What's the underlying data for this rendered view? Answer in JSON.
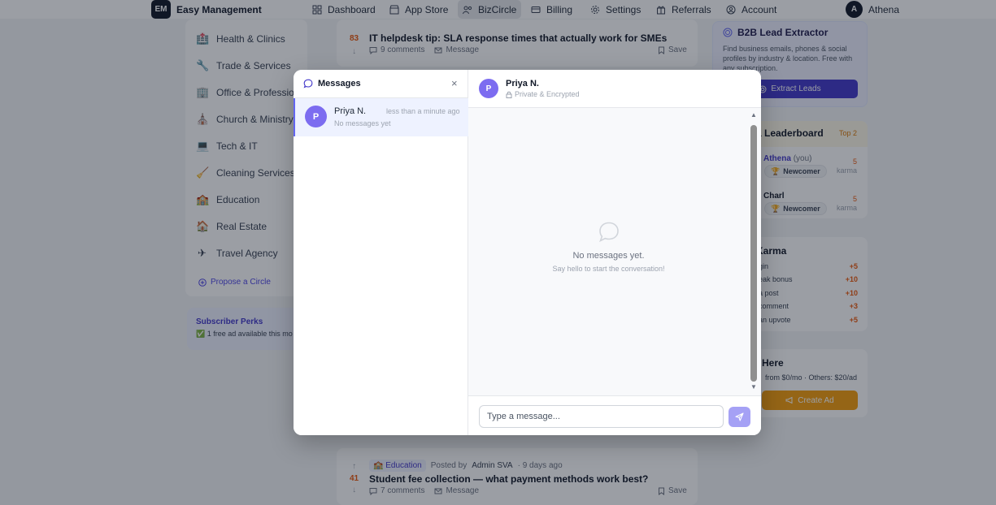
{
  "app": {
    "logo": "EM",
    "name": "Easy Management"
  },
  "nav": [
    {
      "label": "Dashboard",
      "icon": "dashboard-icon"
    },
    {
      "label": "App Store",
      "icon": "store-icon"
    },
    {
      "label": "BizCircle",
      "icon": "users-icon",
      "active": true
    },
    {
      "label": "Billing",
      "icon": "card-icon"
    },
    {
      "label": "Settings",
      "icon": "gear-icon"
    },
    {
      "label": "Referrals",
      "icon": "gift-icon"
    },
    {
      "label": "Account",
      "icon": "user-circle-icon"
    }
  ],
  "user": {
    "initial": "A",
    "name": "Athena"
  },
  "sidebar": {
    "categories": [
      {
        "label": "Health & Clinics",
        "icon": "🏥"
      },
      {
        "label": "Trade & Services",
        "icon": "🔧"
      },
      {
        "label": "Office & Professional",
        "icon": "🏢"
      },
      {
        "label": "Church & Ministry",
        "icon": "⛪"
      },
      {
        "label": "Tech & IT",
        "icon": "💻"
      },
      {
        "label": "Cleaning Services",
        "icon": "🧹"
      },
      {
        "label": "Education",
        "icon": "🏫"
      },
      {
        "label": "Real Estate",
        "icon": "🏠"
      },
      {
        "label": "Travel Agency",
        "icon": "✈"
      }
    ],
    "propose": "Propose a Circle",
    "perks": {
      "title": "Subscriber Perks",
      "line": "✅ 1 free ad available this mo"
    }
  },
  "feed": [
    {
      "votes": "83",
      "title": "IT helpdesk tip: SLA response times that actually work for SMEs",
      "comments": "9 comments",
      "message": "Message",
      "save": "Save"
    },
    {
      "votes": "41",
      "tag": "🏫 Education",
      "posted_by": "Posted by",
      "author": "Admin SVA",
      "age": "· 9 days ago",
      "title": "Student fee collection — what payment methods work best?",
      "comments": "7 comments",
      "message": "Message",
      "save": "Save"
    }
  ],
  "lead": {
    "title": "B2B Lead Extractor",
    "desc": "Find business emails, phones & social profiles by industry & location. Free with any subscription.",
    "button": "Extract Leads"
  },
  "leaderboard": {
    "title": "a Leaderboard",
    "top": "Top 2",
    "entries": [
      {
        "name": "Athena",
        "you": "(you)",
        "badge": "Newcomer",
        "karma": "5",
        "unit": "karma"
      },
      {
        "name": "Charl",
        "badge": "Newcomer",
        "karma": "5",
        "unit": "karma"
      }
    ]
  },
  "karma_rules": {
    "title": "Karma",
    "rows": [
      {
        "label": "gin",
        "value": "+5"
      },
      {
        "label": "eak bonus",
        "value": "+10"
      },
      {
        "label": "a post",
        "value": "+10"
      },
      {
        "label": "comment",
        "value": "+3"
      },
      {
        "label": "an upvote",
        "value": "+5"
      }
    ]
  },
  "ads": {
    "title": "Here",
    "price": "from $0/mo · Others: $20/ad",
    "button": "Create Ad"
  },
  "messages": {
    "title": "Messages",
    "close": "×",
    "conversation": {
      "initial": "P",
      "name": "Priya N.",
      "time": "less than a minute ago",
      "preview": "No messages yet"
    },
    "chat": {
      "name": "Priya N.",
      "subtitle": "Private & Encrypted",
      "empty_title": "No messages yet.",
      "empty_sub": "Say hello to start the conversation!",
      "input_placeholder": "Type a message..."
    }
  }
}
